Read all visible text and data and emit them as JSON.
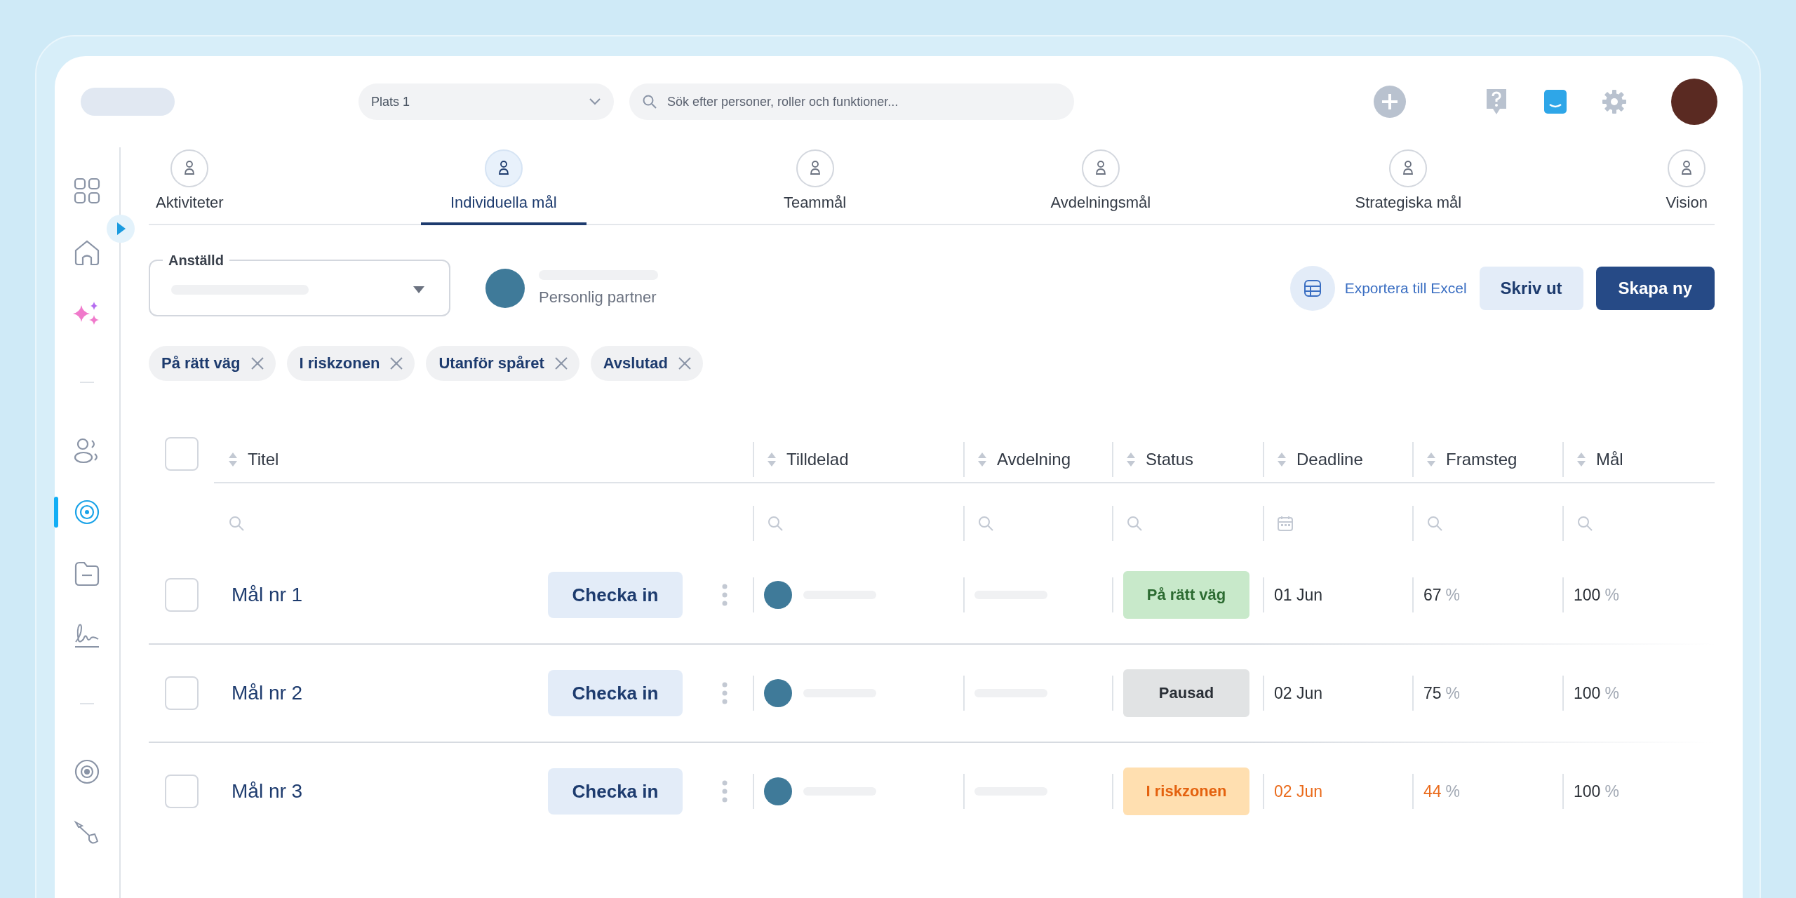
{
  "topbar": {
    "location_select": {
      "value": "Plats 1"
    },
    "search": {
      "placeholder": "Sök efter personer, roller och funktioner..."
    }
  },
  "sidebar": {
    "items": [
      {
        "selected": false
      },
      {
        "selected": false
      },
      {
        "selected": false
      },
      {
        "selected": false
      },
      {
        "selected": true
      },
      {
        "selected": false
      },
      {
        "selected": false
      },
      {
        "selected": false
      },
      {
        "selected": false
      }
    ]
  },
  "tabs": [
    {
      "label": "Aktiviteter",
      "selected": false
    },
    {
      "label": "Individuella mål",
      "selected": true
    },
    {
      "label": "Teammål",
      "selected": false
    },
    {
      "label": "Avdelningsmål",
      "selected": false
    },
    {
      "label": "Strategiska mål",
      "selected": false
    },
    {
      "label": "Vision",
      "selected": false
    }
  ],
  "employee_field": {
    "label": "Anställd"
  },
  "partner": {
    "caption": "Personlig partner"
  },
  "actions": {
    "export": "Exportera till Excel",
    "print": "Skriv ut",
    "create": "Skapa ny"
  },
  "filters": [
    {
      "label": "På rätt väg"
    },
    {
      "label": "I riskzonen"
    },
    {
      "label": "Utanför spåret"
    },
    {
      "label": "Avslutad"
    }
  ],
  "table": {
    "select_all_checked": false,
    "columns": [
      "Titel",
      "Tilldelad",
      "Avdelning",
      "Status",
      "Deadline",
      "Framsteg",
      "Mål"
    ],
    "rows": [
      {
        "checked": false,
        "title": "Mål nr 1",
        "action": "Checka in",
        "status": {
          "label": "På rätt väg",
          "kind": "on_track"
        },
        "deadline": "01 Jun",
        "progress": {
          "value": "67",
          "unit": "%"
        },
        "goal": {
          "value": "100",
          "unit": "%"
        }
      },
      {
        "checked": false,
        "title": "Mål nr 2",
        "action": "Checka in",
        "status": {
          "label": "Pausad",
          "kind": "paused"
        },
        "deadline": "02 Jun",
        "progress": {
          "value": "75",
          "unit": "%"
        },
        "goal": {
          "value": "100",
          "unit": "%"
        }
      },
      {
        "checked": false,
        "title": "Mål nr 3",
        "action": "Checka in",
        "status": {
          "label": "I riskzonen",
          "kind": "at_risk"
        },
        "deadline": "02 Jun",
        "progress": {
          "value": "44",
          "unit": "%"
        },
        "goal": {
          "value": "100",
          "unit": "%"
        }
      }
    ]
  }
}
